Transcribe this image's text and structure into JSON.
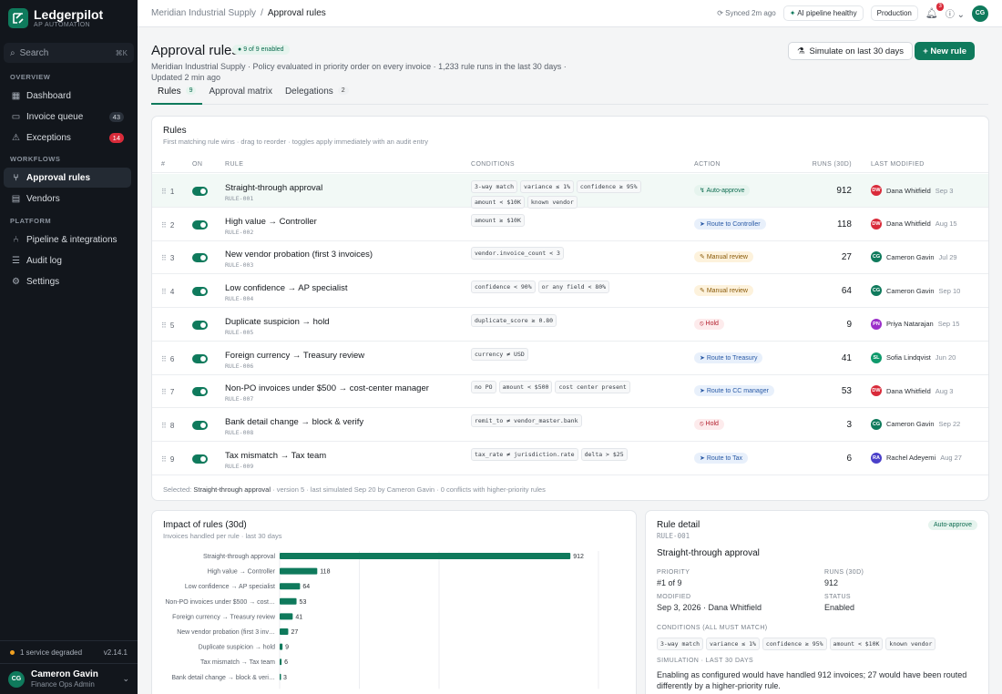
{
  "brand": {
    "name": "Ledgerpilot",
    "sub": "AP AUTOMATION"
  },
  "search": {
    "label": "Search",
    "kbd": "⌘K"
  },
  "sidebar": {
    "overview_label": "OVERVIEW",
    "overview": [
      {
        "label": "Dashboard"
      },
      {
        "label": "Invoice queue",
        "count": "43"
      },
      {
        "label": "Exceptions",
        "count": "14"
      }
    ],
    "workflows_label": "WORKFLOWS",
    "workflows": [
      {
        "label": "Approval rules"
      },
      {
        "label": "Vendors"
      }
    ],
    "platform_label": "PLATFORM",
    "platform": [
      {
        "label": "Pipeline & integrations"
      },
      {
        "label": "Audit log"
      },
      {
        "label": "Settings"
      }
    ],
    "degraded": "1 service degraded",
    "version": "v2.14.1",
    "user": {
      "initials": "CG",
      "name": "Cameron Gavin",
      "role": "Finance Ops Admin"
    }
  },
  "topbar": {
    "org": "Meridian Industrial Supply",
    "page": "Approval rules",
    "synced": "Synced 2m ago",
    "pipeline": "AI pipeline healthy",
    "env": "Production",
    "notif": "3",
    "avatar": "CG"
  },
  "header": {
    "title": "Approval rules",
    "enabled": "9 of 9 enabled",
    "subtitle": "Meridian Industrial Supply · Policy evaluated in priority order on every invoice · 1,233 rule runs in the last 30 days · Updated 2 min ago",
    "simulate": "Simulate on last 30 days",
    "new_rule": "+ New rule"
  },
  "tabs": [
    {
      "label": "Rules",
      "n": "9"
    },
    {
      "label": "Approval matrix",
      "n": ""
    },
    {
      "label": "Delegations",
      "n": "2"
    }
  ],
  "rules_card": {
    "title": "Rules",
    "sub": "First matching rule wins · drag to reorder · toggles apply immediately with an audit entry",
    "cols": {
      "num": "#",
      "on": "ON",
      "rule": "RULE",
      "conditions": "CONDITIONS",
      "action": "ACTION",
      "runs": "RUNS (30D)",
      "modified": "LAST MODIFIED"
    },
    "footer_pre": "Selected:",
    "footer_sel": "Straight-through approval",
    "footer_post": "· version 5 · last simulated Sep 20 by Cameron Gavin · 0 conflicts with higher-priority rules"
  },
  "rules": [
    {
      "n": "1",
      "name": "Straight-through approval",
      "id": "RULE-001",
      "conds": [
        "3-way match",
        "variance ≤ 1%",
        "confidence ≥ 95%",
        "amount < $10K",
        "known vendor"
      ],
      "action": "Auto-approve",
      "action_icon": "↯",
      "tone": "green",
      "runs": "912",
      "initials": "DW",
      "avc": "#d92b3a",
      "by": "Dana Whitfield",
      "date": "Sep 3"
    },
    {
      "n": "2",
      "name": "High value → Controller",
      "id": "RULE-002",
      "conds": [
        "amount ≥ $10K"
      ],
      "action": "Route to Controller",
      "action_icon": "➤",
      "tone": "blue",
      "runs": "118",
      "initials": "DW",
      "avc": "#d92b3a",
      "by": "Dana Whitfield",
      "date": "Aug 15"
    },
    {
      "n": "3",
      "name": "New vendor probation (first 3 invoices)",
      "id": "RULE-003",
      "conds": [
        "vendor.invoice_count < 3"
      ],
      "action": "Manual review",
      "action_icon": "✎",
      "tone": "amber",
      "runs": "27",
      "initials": "CG",
      "avc": "#0f7a5c",
      "by": "Cameron Gavin",
      "date": "Jul 29"
    },
    {
      "n": "4",
      "name": "Low confidence → AP specialist",
      "id": "RULE-004",
      "conds": [
        "confidence < 90%",
        "or any field < 80%"
      ],
      "action": "Manual review",
      "action_icon": "✎",
      "tone": "amber",
      "runs": "64",
      "initials": "CG",
      "avc": "#0f7a5c",
      "by": "Cameron Gavin",
      "date": "Sep 10"
    },
    {
      "n": "5",
      "name": "Duplicate suspicion → hold",
      "id": "RULE-005",
      "conds": [
        "duplicate_score ≥ 0.80"
      ],
      "action": "Hold",
      "action_icon": "⦸",
      "tone": "red",
      "runs": "9",
      "initials": "PN",
      "avc": "#9b2fc9",
      "by": "Priya Natarajan",
      "date": "Sep 15"
    },
    {
      "n": "6",
      "name": "Foreign currency → Treasury review",
      "id": "RULE-006",
      "conds": [
        "currency ≠ USD"
      ],
      "action": "Route to Treasury",
      "action_icon": "➤",
      "tone": "blue",
      "runs": "41",
      "initials": "SL",
      "avc": "#0f9a6c",
      "by": "Sofia Lindqvist",
      "date": "Jun 20"
    },
    {
      "n": "7",
      "name": "Non-PO invoices under $500 → cost-center manager",
      "id": "RULE-007",
      "conds": [
        "no PO",
        "amount < $500",
        "cost center present"
      ],
      "action": "Route to CC manager",
      "action_icon": "➤",
      "tone": "blue",
      "runs": "53",
      "initials": "DW",
      "avc": "#d92b3a",
      "by": "Dana Whitfield",
      "date": "Aug 3"
    },
    {
      "n": "8",
      "name": "Bank detail change → block & verify",
      "id": "RULE-008",
      "conds": [
        "remit_to ≠ vendor_master.bank"
      ],
      "action": "Hold",
      "action_icon": "⦸",
      "tone": "red",
      "runs": "3",
      "initials": "CG",
      "avc": "#0f7a5c",
      "by": "Cameron Gavin",
      "date": "Sep 22"
    },
    {
      "n": "9",
      "name": "Tax mismatch → Tax team",
      "id": "RULE-009",
      "conds": [
        "tax_rate ≠ jurisdiction.rate",
        "delta > $25"
      ],
      "action": "Route to Tax",
      "action_icon": "➤",
      "tone": "blue",
      "runs": "6",
      "initials": "RA",
      "avc": "#4a3fc9",
      "by": "Rachel Adeyemi",
      "date": "Aug 27"
    }
  ],
  "impact": {
    "title": "Impact of rules (30d)",
    "sub": "Invoices handled per rule · last 30 days"
  },
  "chart_data": {
    "type": "bar",
    "orientation": "horizontal",
    "categories": [
      "Straight-through approval",
      "High value → Controller",
      "Low confidence → AP specialist",
      "Non-PO invoices under $500 → cost…",
      "Foreign currency → Treasury review",
      "New vendor probation (first 3 inv…",
      "Duplicate suspicion → hold",
      "Tax mismatch → Tax team",
      "Bank detail change → block & veri…"
    ],
    "values": [
      912,
      118,
      64,
      53,
      41,
      27,
      9,
      6,
      3
    ],
    "xlim": [
      0,
      1000
    ],
    "ticks": [
      0,
      250,
      500,
      "1,000"
    ],
    "tick_values": [
      0,
      250,
      500,
      1000
    ],
    "color": "#0f7a5c",
    "grid": true
  },
  "detail": {
    "title": "Rule detail",
    "id": "RULE-001",
    "badge": "Auto-approve",
    "name": "Straight-through approval",
    "priority_k": "PRIORITY",
    "priority": "#1 of 9",
    "runs_k": "RUNS (30D)",
    "runs": "912",
    "modified_k": "MODIFIED",
    "modified": "Sep 3, 2026 · Dana Whitfield",
    "status_k": "STATUS",
    "status": "Enabled",
    "conds_k": "CONDITIONS (ALL MUST MATCH)",
    "conds": [
      "3-way match",
      "variance ≤ 1%",
      "confidence ≥ 95%",
      "amount < $10K",
      "known vendor"
    ],
    "sim_k": "SIMULATION · LAST 30 DAYS",
    "sim": "Enabling as configured would have handled 912 invoices; 27 would have been routed differently by a higher-priority rule."
  }
}
